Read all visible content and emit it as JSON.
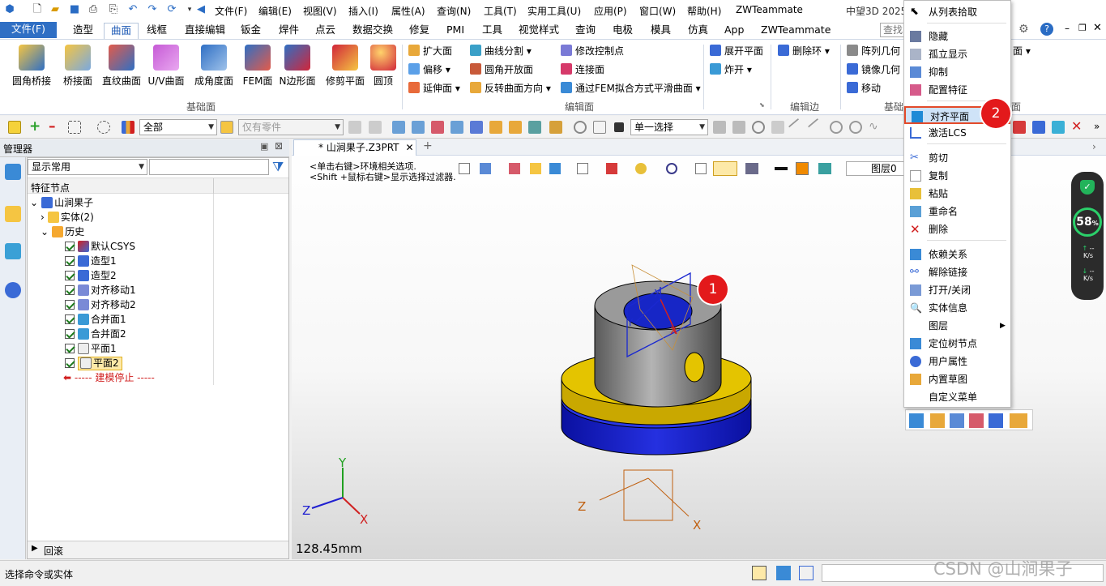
{
  "app": {
    "title": "中望3D 2025 x",
    "search_placeholder": "查找"
  },
  "menubar": [
    "文件(F)",
    "编辑(E)",
    "视图(V)",
    "插入(I)",
    "属性(A)",
    "查询(N)",
    "工具(T)",
    "实用工具(U)",
    "应用(P)",
    "窗口(W)",
    "帮助(H)",
    "ZWTeammate"
  ],
  "ribbon_tabs": [
    "文件(F)",
    "造型",
    "曲面",
    "线框",
    "直接编辑",
    "钣金",
    "焊件",
    "点云",
    "数据交换",
    "修复",
    "PMI",
    "工具",
    "视觉样式",
    "查询",
    "电极",
    "模具",
    "仿真",
    "App",
    "ZWTeammate"
  ],
  "active_tab": "曲面",
  "ribbon": {
    "big_buttons": [
      "圆角桥接",
      "桥接面",
      "直纹曲面",
      "U/V曲面",
      "成角度面",
      "FEM面",
      "N边形面",
      "修剪平面",
      "圆顶"
    ],
    "group_base": "基础面",
    "edit_col1": [
      "扩大面",
      "偏移",
      "延伸面"
    ],
    "edit_col2": [
      "曲线分割",
      "圆角开放面",
      "反转曲面方向"
    ],
    "edit_col3": [
      "修改控制点",
      "连接面",
      "通过FEM拟合方式平滑曲面"
    ],
    "group_edit": "编辑面",
    "edge_items": [
      "展开平面",
      "炸开"
    ],
    "edge_extra": "删除环",
    "group_edge": "编辑边",
    "more_items": [
      "阵列几何",
      "镜像几何",
      "移动"
    ],
    "group_more": "基础",
    "more_tail": "面",
    "group_tail": "面"
  },
  "toolbar2": {
    "filter_all": "全部",
    "parts_only": "仅有零件",
    "select_mode": "单一选择"
  },
  "manager": {
    "title": "管理器",
    "display": "显示常用",
    "column": "特征节点",
    "rollback": "回滚"
  },
  "tree": [
    {
      "label": "山涧果子",
      "level": 0
    },
    {
      "label": "实体(2)",
      "level": 1
    },
    {
      "label": "历史",
      "level": 1
    },
    {
      "label": "默认CSYS",
      "level": 2
    },
    {
      "label": "造型1",
      "level": 2
    },
    {
      "label": "造型2",
      "level": 2
    },
    {
      "label": "对齐移动1",
      "level": 2
    },
    {
      "label": "对齐移动2",
      "level": 2
    },
    {
      "label": "合并面1",
      "level": 2
    },
    {
      "label": "合并面2",
      "level": 2
    },
    {
      "label": "平面1",
      "level": 2
    },
    {
      "label": "平面2",
      "level": 2,
      "selected": true
    },
    {
      "label": "----- 建模停止 -----",
      "level": 2,
      "stop": true
    }
  ],
  "viewport": {
    "tab": "* 山涧果子.Z3PRT",
    "hint1": "<单击右键>环境相关选项.",
    "hint2": "<Shift +鼠标右键>显示选择过滤器.",
    "layer_label": "图层0",
    "scale": "128.45mm",
    "axes": {
      "x": "X",
      "y": "Y",
      "z": "Z"
    }
  },
  "perf": {
    "percent": "58",
    "unit": "%",
    "up": "--",
    "down": "--",
    "rate": "K/s"
  },
  "status": {
    "message": "选择命令或实体",
    "watermark": "CSDN @山涧果子"
  },
  "context_menu": {
    "items": [
      "从列表拾取",
      "隐藏",
      "孤立显示",
      "抑制",
      "配置特征",
      "对齐平面",
      "激活LCS",
      "剪切",
      "复制",
      "粘贴",
      "重命名",
      "删除",
      "依赖关系",
      "解除链接",
      "打开/关闭",
      "实体信息",
      "图层",
      "定位树节点",
      "用户属性",
      "内置草图",
      "自定义菜单"
    ],
    "highlighted": "对齐平面"
  },
  "callouts": [
    "1",
    "2"
  ],
  "colors": {
    "accent": "#2f6fc4",
    "badge": "#e3191b",
    "yellow": "#e4c400",
    "blue": "#1a20c8",
    "gray": "#8e8e8e"
  }
}
